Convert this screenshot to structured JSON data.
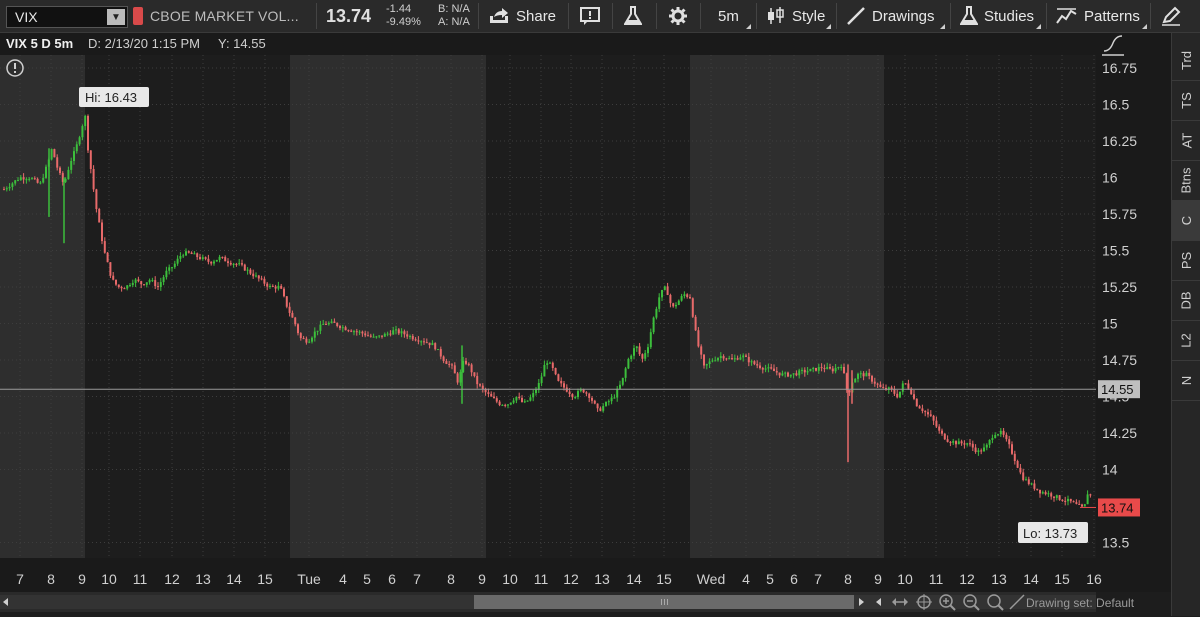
{
  "toolbar": {
    "symbol": "VIX",
    "description": "CBOE MARKET VOL...",
    "last": "13.74",
    "change": "-1.44",
    "change_pct": "-9.49%",
    "bid": "B: N/A",
    "ask": "A: N/A",
    "share_label": "Share",
    "timeframe_label": "5m",
    "style_label": "Style",
    "drawings_label": "Drawings",
    "studies_label": "Studies",
    "patterns_label": "Patterns"
  },
  "subheader": {
    "symbol_period": "VIX 5 D 5m",
    "date": "D: 2/13/20 1:15 PM",
    "y": "Y: 14.55"
  },
  "chart_data": {
    "type": "candlestick",
    "y_ticks": [
      "16.75",
      "16.5",
      "16.25",
      "16",
      "15.75",
      "15.5",
      "15.25",
      "15",
      "14.75",
      "14.5",
      "14.25",
      "14",
      "13.5"
    ],
    "ylim": [
      13.4,
      16.85
    ],
    "x_ticks": [
      "7",
      "8",
      "9",
      "10",
      "11",
      "12",
      "13",
      "14",
      "15",
      "Tue",
      "4",
      "5",
      "6",
      "7",
      "8",
      "9",
      "10",
      "11",
      "12",
      "13",
      "14",
      "15",
      "Wed",
      "4",
      "5",
      "6",
      "7",
      "8",
      "9",
      "10",
      "11",
      "12",
      "13",
      "14",
      "15",
      "16"
    ],
    "hi_label": "Hi: 16.43",
    "lo_label": "Lo: 13.73",
    "crosshair_value": "14.55",
    "last_value": "13.74",
    "price_path": [
      [
        0,
        15.9
      ],
      [
        10,
        15.95
      ],
      [
        20,
        16.0
      ],
      [
        30,
        16.0
      ],
      [
        40,
        15.95
      ],
      [
        48,
        16.1
      ],
      [
        52,
        16.2
      ],
      [
        58,
        16.05
      ],
      [
        64,
        15.95
      ],
      [
        70,
        16.1
      ],
      [
        76,
        16.2
      ],
      [
        82,
        16.35
      ],
      [
        85,
        16.43
      ],
      [
        88,
        16.2
      ],
      [
        92,
        16.0
      ],
      [
        96,
        15.8
      ],
      [
        100,
        15.65
      ],
      [
        104,
        15.5
      ],
      [
        108,
        15.4
      ],
      [
        112,
        15.3
      ],
      [
        118,
        15.25
      ],
      [
        126,
        15.25
      ],
      [
        134,
        15.3
      ],
      [
        142,
        15.27
      ],
      [
        150,
        15.3
      ],
      [
        158,
        15.25
      ],
      [
        166,
        15.35
      ],
      [
        174,
        15.4
      ],
      [
        182,
        15.48
      ],
      [
        190,
        15.48
      ],
      [
        200,
        15.45
      ],
      [
        210,
        15.42
      ],
      [
        220,
        15.45
      ],
      [
        230,
        15.42
      ],
      [
        240,
        15.4
      ],
      [
        250,
        15.35
      ],
      [
        260,
        15.3
      ],
      [
        270,
        15.25
      ],
      [
        280,
        15.25
      ],
      [
        288,
        15.1
      ],
      [
        295,
        15.0
      ],
      [
        300,
        14.9
      ],
      [
        308,
        14.88
      ],
      [
        316,
        14.95
      ],
      [
        324,
        15.0
      ],
      [
        334,
        15.0
      ],
      [
        344,
        14.97
      ],
      [
        354,
        14.95
      ],
      [
        364,
        14.93
      ],
      [
        374,
        14.9
      ],
      [
        384,
        14.92
      ],
      [
        394,
        14.95
      ],
      [
        404,
        14.93
      ],
      [
        414,
        14.9
      ],
      [
        424,
        14.88
      ],
      [
        434,
        14.85
      ],
      [
        444,
        14.75
      ],
      [
        452,
        14.7
      ],
      [
        458,
        14.6
      ],
      [
        464,
        14.75
      ],
      [
        470,
        14.7
      ],
      [
        476,
        14.6
      ],
      [
        482,
        14.55
      ],
      [
        490,
        14.5
      ],
      [
        500,
        14.45
      ],
      [
        508,
        14.45
      ],
      [
        516,
        14.5
      ],
      [
        524,
        14.45
      ],
      [
        532,
        14.5
      ],
      [
        540,
        14.6
      ],
      [
        546,
        14.75
      ],
      [
        552,
        14.7
      ],
      [
        558,
        14.6
      ],
      [
        566,
        14.55
      ],
      [
        574,
        14.5
      ],
      [
        582,
        14.55
      ],
      [
        590,
        14.5
      ],
      [
        598,
        14.4
      ],
      [
        606,
        14.45
      ],
      [
        614,
        14.5
      ],
      [
        622,
        14.6
      ],
      [
        628,
        14.75
      ],
      [
        636,
        14.85
      ],
      [
        642,
        14.75
      ],
      [
        648,
        14.85
      ],
      [
        654,
        15.05
      ],
      [
        660,
        15.2
      ],
      [
        666,
        15.25
      ],
      [
        672,
        15.1
      ],
      [
        678,
        15.15
      ],
      [
        684,
        15.2
      ],
      [
        690,
        15.18
      ],
      [
        697,
        14.88
      ],
      [
        704,
        14.7
      ],
      [
        712,
        14.75
      ],
      [
        722,
        14.78
      ],
      [
        732,
        14.75
      ],
      [
        742,
        14.78
      ],
      [
        752,
        14.73
      ],
      [
        762,
        14.7
      ],
      [
        772,
        14.68
      ],
      [
        782,
        14.65
      ],
      [
        792,
        14.65
      ],
      [
        802,
        14.67
      ],
      [
        812,
        14.68
      ],
      [
        822,
        14.7
      ],
      [
        832,
        14.68
      ],
      [
        842,
        14.72
      ],
      [
        848,
        14.5
      ],
      [
        852,
        14.6
      ],
      [
        858,
        14.65
      ],
      [
        866,
        14.65
      ],
      [
        874,
        14.6
      ],
      [
        882,
        14.55
      ],
      [
        890,
        14.55
      ],
      [
        898,
        14.5
      ],
      [
        904,
        14.6
      ],
      [
        910,
        14.55
      ],
      [
        916,
        14.45
      ],
      [
        924,
        14.4
      ],
      [
        932,
        14.35
      ],
      [
        940,
        14.25
      ],
      [
        948,
        14.2
      ],
      [
        958,
        14.18
      ],
      [
        968,
        14.18
      ],
      [
        978,
        14.12
      ],
      [
        986,
        14.15
      ],
      [
        994,
        14.25
      ],
      [
        1002,
        14.25
      ],
      [
        1010,
        14.15
      ],
      [
        1016,
        14.05
      ],
      [
        1022,
        13.95
      ],
      [
        1030,
        13.9
      ],
      [
        1040,
        13.85
      ],
      [
        1050,
        13.83
      ],
      [
        1060,
        13.8
      ],
      [
        1070,
        13.78
      ],
      [
        1078,
        13.75
      ],
      [
        1084,
        13.73
      ],
      [
        1088,
        13.85
      ],
      [
        1092,
        13.8
      ]
    ]
  },
  "right_panel": [
    "Trd",
    "TS",
    "AT",
    "Btns",
    "C",
    "PS",
    "DB",
    "L2",
    "N"
  ],
  "drawing_set_label": "Drawing set: Default",
  "colors": {
    "up": "#3cbf3c",
    "down": "#e86a6a",
    "last_badge": "#e84a4a",
    "crosshair_badge": "#bfbfbf",
    "session_band": "#2e2e2e",
    "background": "#1d1d1d"
  }
}
